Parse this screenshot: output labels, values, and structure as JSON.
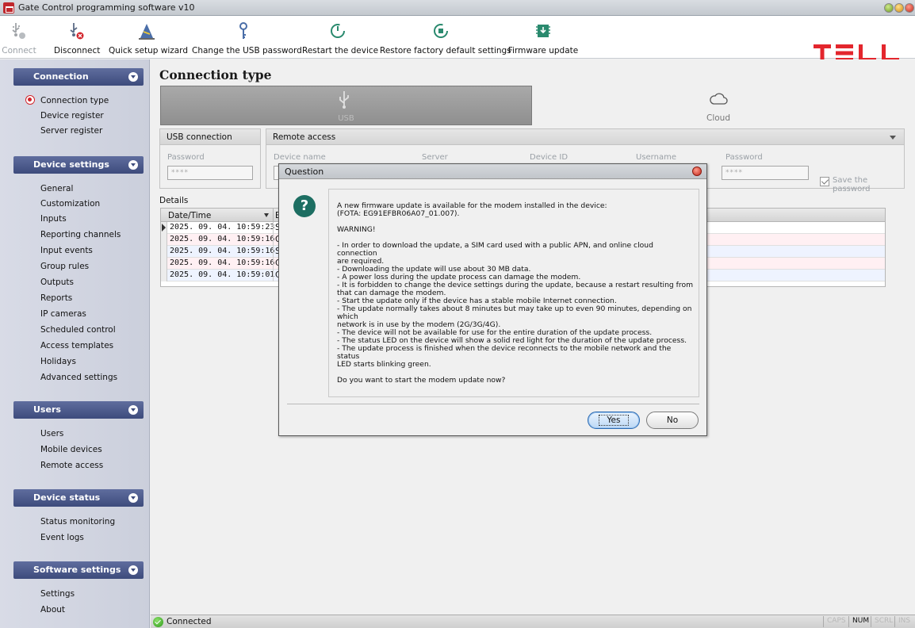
{
  "window": {
    "title": "Gate Control programming software v10"
  },
  "toolbar": {
    "items": [
      {
        "label": "Connect",
        "icon": "usb-disabled-icon"
      },
      {
        "label": "Disconnect",
        "icon": "usb-disconnect-icon"
      },
      {
        "label": "Quick setup wizard",
        "icon": "wizard-icon"
      },
      {
        "label": "Change the USB password",
        "icon": "key-icon"
      },
      {
        "label": "Restart the device",
        "icon": "restart-icon"
      },
      {
        "label": "Restore factory default settings",
        "icon": "restore-icon"
      },
      {
        "label": "Firmware update",
        "icon": "chip-update-icon"
      }
    ],
    "brand": "TELL",
    "brand_color": "#e3262d"
  },
  "sidebar": {
    "sections": [
      {
        "title": "Connection",
        "items": [
          "Connection type",
          "Device register",
          "Server register"
        ]
      },
      {
        "title": "Device settings",
        "items": [
          "General",
          "Customization",
          "Inputs",
          "Reporting channels",
          "Input events",
          "Group rules",
          "Outputs",
          "Reports",
          "IP cameras",
          "Scheduled control",
          "Access templates",
          "Holidays",
          "Advanced settings"
        ]
      },
      {
        "title": "Users",
        "items": [
          "Users",
          "Mobile devices",
          "Remote access"
        ]
      },
      {
        "title": "Device status",
        "items": [
          "Status monitoring",
          "Event logs"
        ]
      },
      {
        "title": "Software settings",
        "items": [
          "Settings",
          "About"
        ]
      }
    ]
  },
  "main": {
    "title": "Connection type",
    "conn_options": {
      "usb": "USB",
      "cloud": "Cloud"
    },
    "usb_panel": {
      "title": "USB connection",
      "password_label": "Password",
      "password_value": "****"
    },
    "remote_panel": {
      "title": "Remote access",
      "labels": {
        "device_name": "Device name",
        "server": "Server",
        "device_id": "Device ID",
        "username": "Username",
        "password": "Password"
      },
      "password_value": "****",
      "save_password": "Save the password"
    },
    "details": {
      "label": "Details",
      "columns": [
        "Date/Time",
        "E"
      ],
      "rows": [
        {
          "date": "2025. 09. 04. 10:59:23",
          "e": "S"
        },
        {
          "date": "2025. 09. 04. 10:59:16",
          "e": "G"
        },
        {
          "date": "2025. 09. 04. 10:59:16",
          "e": "S"
        },
        {
          "date": "2025. 09. 04. 10:59:16",
          "e": "C"
        },
        {
          "date": "2025. 09. 04. 10:59:01",
          "e": "C"
        }
      ]
    }
  },
  "statusbar": {
    "status": "Connected",
    "keys": [
      "CAPS",
      "NUM",
      "SCRL",
      "INS"
    ]
  },
  "dialog": {
    "title": "Question",
    "icon": "question-icon",
    "text": "A new firmware update is available for the modem installed in the device:\n(FOTA: EG91EFBR06A07_01.007).\n\nWARNING!\n\n- In order to download the update, a SIM card used with a public APN, and online cloud connection\n   are required.\n- Downloading the update will use about 30 MB data.\n- A power loss during the update process can damage the modem.\n- It is forbidden to change the device settings during the update, because a restart resulting from\n   that can damage the modem.\n- Start the update only if the device has a stable mobile Internet connection.\n- The update normally takes about 8 minutes but may take up to even 90 minutes, depending on which\n   network is in use by the modem (2G/3G/4G).\n- The device will not be available for use for the entire duration of the update process.\n- The status LED on the device will show a solid red light for the duration of the update process.\n- The update process is finished when the device reconnects to the mobile network and the status\n   LED starts blinking green.\n\nDo you want to start the modem update now?",
    "yes": "Yes",
    "no": "No"
  }
}
